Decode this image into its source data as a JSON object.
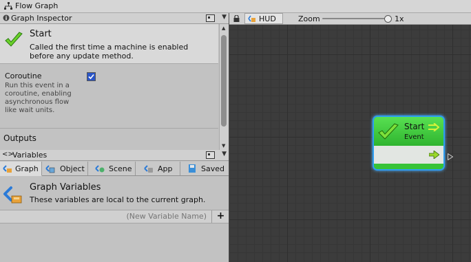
{
  "window": {
    "title": "Flow Graph"
  },
  "inspector": {
    "title": "Graph Inspector",
    "unit": {
      "name": "Start",
      "description_line1": "Called the first time a machine is enabled",
      "description_line2": "before any update method."
    },
    "coroutine": {
      "label": "Coroutine",
      "checked": true,
      "desc_lines": [
        "Run this event in a",
        "coroutine, enabling",
        "asynchronous flow",
        "like wait units."
      ]
    },
    "outputs_label": "Outputs"
  },
  "variables": {
    "title": "Variables",
    "tabs": [
      {
        "label": "Graph",
        "active": true
      },
      {
        "label": "Object",
        "active": false
      },
      {
        "label": "Scene",
        "active": false
      },
      {
        "label": "App",
        "active": false
      },
      {
        "label": "Saved",
        "active": false
      }
    ],
    "section_title": "Graph Variables",
    "section_desc": "These variables are local to the current graph.",
    "new_var_placeholder": "(New Variable Name)",
    "add_label": "+"
  },
  "toolbar": {
    "hud_label": "HUD",
    "zoom_label": "Zoom",
    "zoom_value": "1x",
    "zoom_level": 1.0
  },
  "node": {
    "title": "Start",
    "subtitle": "Event"
  },
  "colors": {
    "node_green": "#3ec43e",
    "selection_blue": "#2d9df2",
    "graph_bg": "#3c3c3c"
  }
}
